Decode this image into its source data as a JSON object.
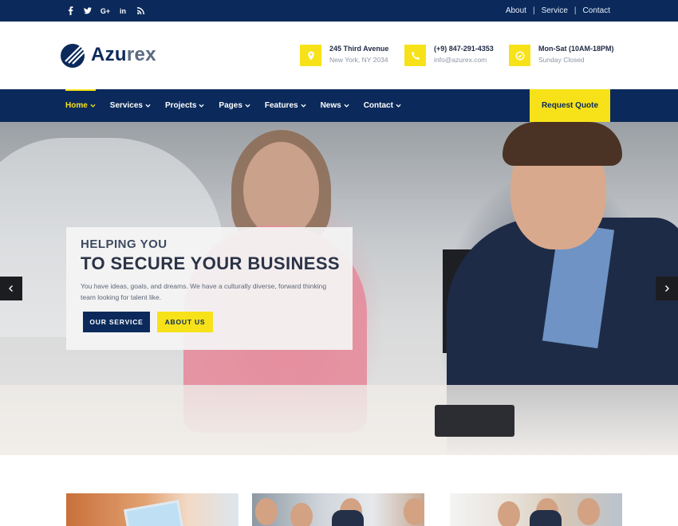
{
  "topbar": {
    "social": [
      {
        "name": "facebook-icon",
        "glyph": "f"
      },
      {
        "name": "twitter-icon",
        "glyph": "t"
      },
      {
        "name": "google-plus-icon",
        "glyph": "G+"
      },
      {
        "name": "linkedin-icon",
        "glyph": "in"
      },
      {
        "name": "rss-icon",
        "glyph": "rss"
      }
    ],
    "links": [
      "About",
      "Service",
      "Contact"
    ],
    "separator": "|"
  },
  "header": {
    "logo": {
      "part1": "Azu",
      "part2": "rex"
    },
    "info": [
      {
        "icon": "map-pin-icon",
        "line1": "245 Third Avenue",
        "line2": "New York, NY 2034"
      },
      {
        "icon": "phone-icon",
        "line1": "(+9) 847-291-4353",
        "line2": "info@azurex.com"
      },
      {
        "icon": "clock-icon",
        "line1": "Mon-Sat (10AM-18PM)",
        "line2": "Sunday Closed"
      }
    ]
  },
  "nav": {
    "items": [
      "Home",
      "Services",
      "Projects",
      "Pages",
      "Features",
      "News",
      "Contact"
    ],
    "active": "Home",
    "cta": "Request Quote"
  },
  "hero": {
    "kicker": "HELPING YOU",
    "headline": "TO SECURE YOUR BUSINESS",
    "description": "You have ideas, goals, and dreams. We have a culturally diverse, forward thinking team looking for talent like.",
    "primary_button": "OUR SERVICE",
    "secondary_button": "ABOUT US"
  },
  "colors": {
    "navy": "#0b2a5b",
    "accent_yellow": "#f7e219",
    "text_dark": "#1f2a44",
    "text_muted": "#8c95a3"
  }
}
